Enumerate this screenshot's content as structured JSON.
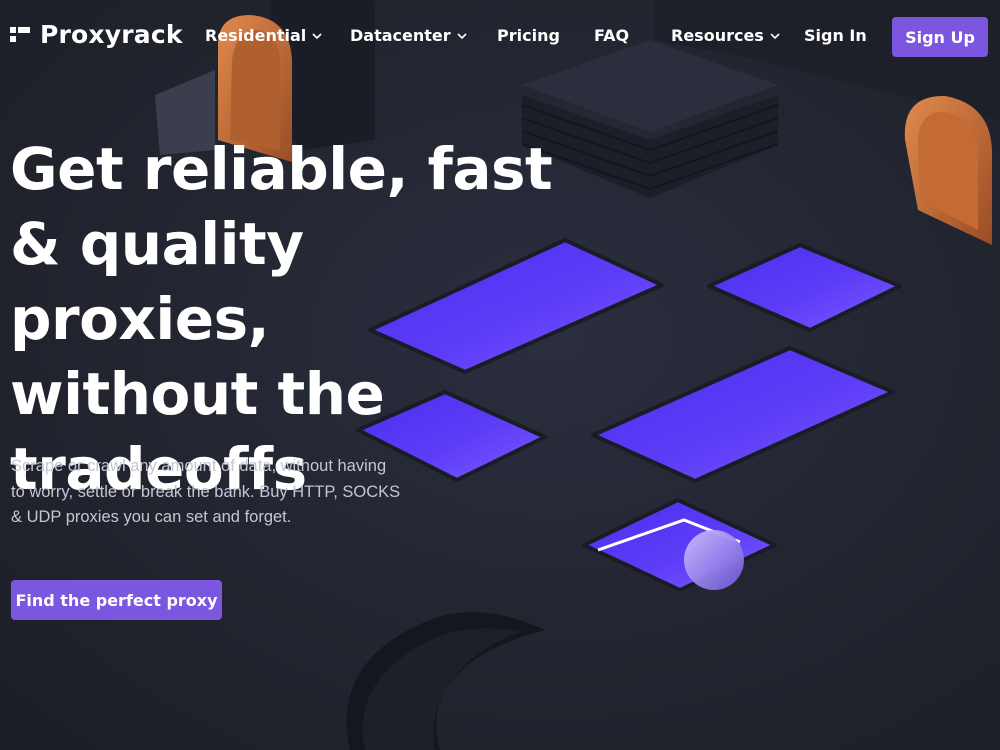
{
  "brand": {
    "name": "Proxyrack",
    "logo_icon": "proxyrack-logo-icon"
  },
  "nav": {
    "items": [
      {
        "label": "Residential",
        "dropdown": true
      },
      {
        "label": "Datacenter",
        "dropdown": true
      },
      {
        "label": "Pricing",
        "dropdown": false
      },
      {
        "label": "FAQ",
        "dropdown": false
      },
      {
        "label": "Resources",
        "dropdown": true
      },
      {
        "label": "Sign In",
        "dropdown": false
      }
    ],
    "signup_label": "Sign Up"
  },
  "hero": {
    "title_lines": [
      "Get reliable, fast",
      "& quality proxies,",
      "without the",
      "tradeoffs"
    ],
    "subtitle": "Scrape or crawl any amount of data, without having to worry, settle or break the bank. Buy HTTP, SOCKS & UDP proxies you can set and forget.",
    "cta_label": "Find the perfect proxy"
  },
  "colors": {
    "background": "#222532",
    "accent": "#7b57e0",
    "glow": "#5b3cf5",
    "copper": "#c96f38",
    "text": "#ffffff",
    "muted_text": "#c4c7d2"
  }
}
